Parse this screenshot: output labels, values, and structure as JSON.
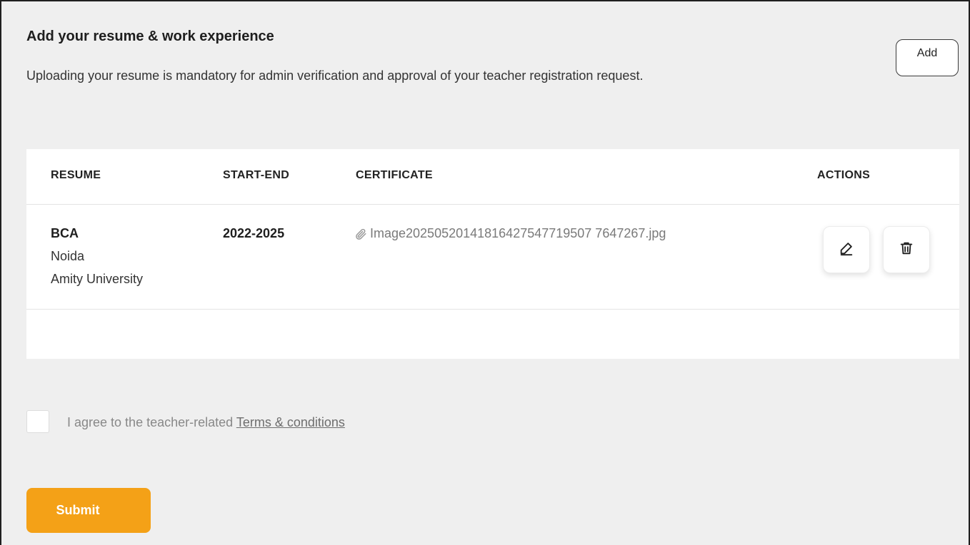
{
  "header": {
    "title": "Add your resume & work experience",
    "subtitle": "Uploading your resume is mandatory for admin verification and approval of your teacher registration request.",
    "add_label": "Add"
  },
  "table": {
    "columns": [
      "RESUME",
      "START-END",
      "CERTIFICATE",
      "ACTIONS"
    ],
    "rows": [
      {
        "degree": "BCA",
        "location": "Noida",
        "institution": "Amity University",
        "start_end": "2022-2025",
        "certificate": "Image20250520141816427547719507 7647267.jpg"
      }
    ]
  },
  "agreement": {
    "text": "I agree to the teacher-related ",
    "link": "Terms & conditions",
    "checked": false
  },
  "submit_label": "Submit",
  "icons": {
    "attachment": "paperclip-icon",
    "edit": "pencil-icon",
    "delete": "trash-icon"
  },
  "colors": {
    "accent": "#f4a117",
    "background": "#efefef"
  }
}
